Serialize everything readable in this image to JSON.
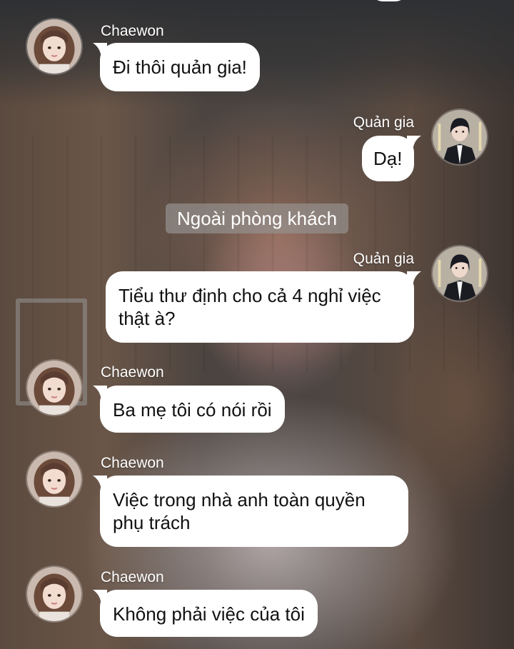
{
  "chat": {
    "messages": [
      {
        "sender": "Chaewon",
        "side": "left",
        "avatar": "avatar-chaewon",
        "text": "Đi thôi quản gia!"
      },
      {
        "sender": "Quản gia",
        "side": "right",
        "avatar": "avatar-butler",
        "text": "Dạ!"
      },
      {
        "system": "Ngoài phòng khách"
      },
      {
        "sender": "Quản gia",
        "side": "right",
        "avatar": "avatar-butler",
        "lines": [
          "Tiểu thư định cho cả 4 nghỉ việc",
          "thật à?"
        ]
      },
      {
        "sender": "Chaewon",
        "side": "left",
        "avatar": "avatar-chaewon",
        "text": "Ba mẹ tôi có nói rồi"
      },
      {
        "sender": "Chaewon",
        "side": "left",
        "avatar": "avatar-chaewon",
        "lines": [
          "Việc trong nhà anh toàn quyền",
          "phụ trách"
        ]
      },
      {
        "sender": "Chaewon",
        "side": "left",
        "avatar": "avatar-chaewon",
        "text": "Không phải việc của tôi"
      }
    ]
  },
  "colors": {
    "bubble": "#ffffff",
    "system_badge": "#96918f",
    "name_text": "#ffffff"
  }
}
